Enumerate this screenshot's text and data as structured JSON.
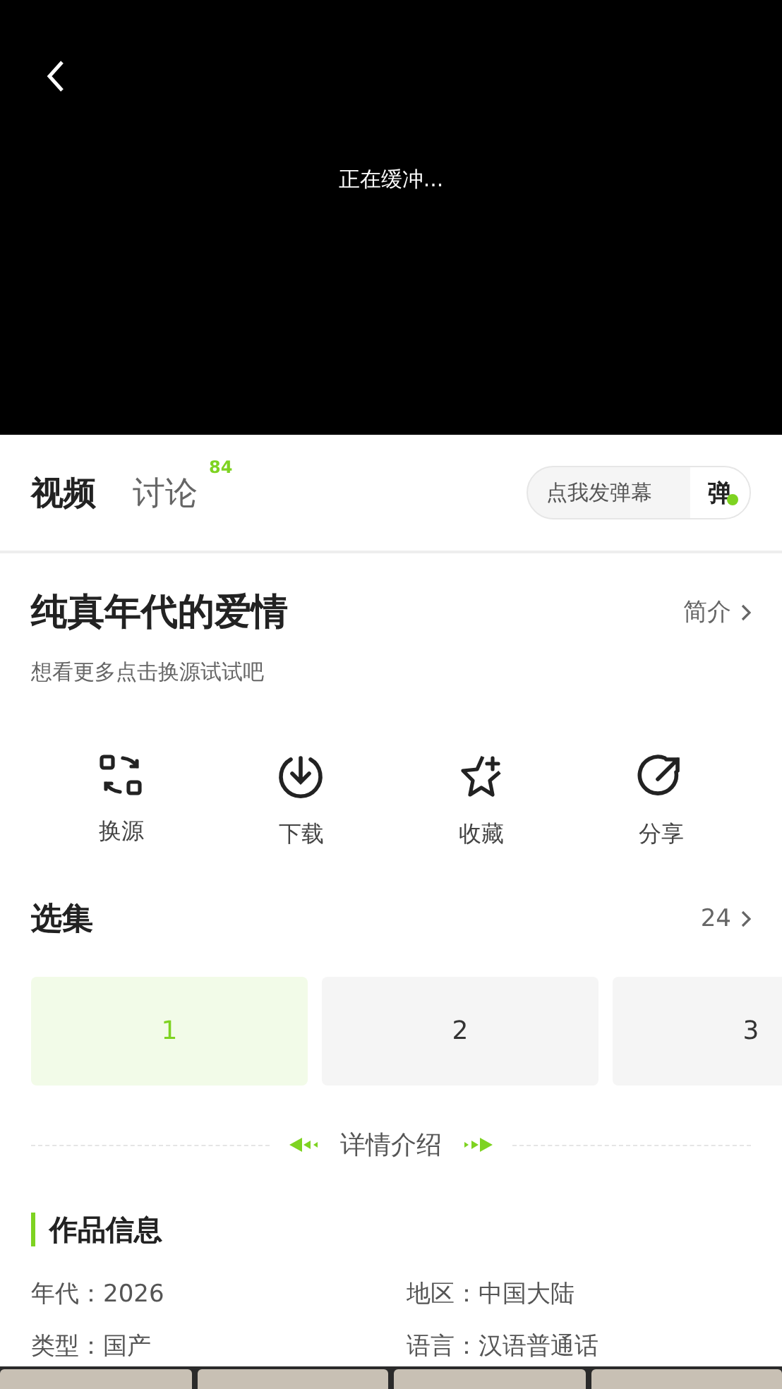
{
  "player": {
    "status": "正在缓冲..."
  },
  "tabs": [
    {
      "label": "视频",
      "selected": true
    },
    {
      "label": "讨论",
      "selected": false,
      "badge": "84"
    }
  ],
  "danmaku": {
    "placeholder": "点我发弹幕",
    "toggle": "弹",
    "on": true
  },
  "title": "纯真年代的爱情",
  "intro_link": "简介",
  "hint": "想看更多点击换源试试吧",
  "actions": [
    {
      "kind": "switch",
      "label": "换源"
    },
    {
      "kind": "download",
      "label": "下载"
    },
    {
      "kind": "favorite",
      "label": "收藏"
    },
    {
      "kind": "share",
      "label": "分享"
    }
  ],
  "episodes": {
    "title": "选集",
    "count": "24",
    "items": [
      {
        "label": "1",
        "selected": true
      },
      {
        "label": "2",
        "selected": false
      },
      {
        "label": "3",
        "selected": false
      }
    ]
  },
  "divider_label": "详情介绍",
  "info": {
    "title": "作品信息",
    "fields": [
      {
        "label": "年代：",
        "value": "2026"
      },
      {
        "label": "地区：",
        "value": "中国大陆"
      },
      {
        "label": "类型：",
        "value": "国产"
      },
      {
        "label": "语言：",
        "value": "汉语普通话"
      }
    ]
  }
}
